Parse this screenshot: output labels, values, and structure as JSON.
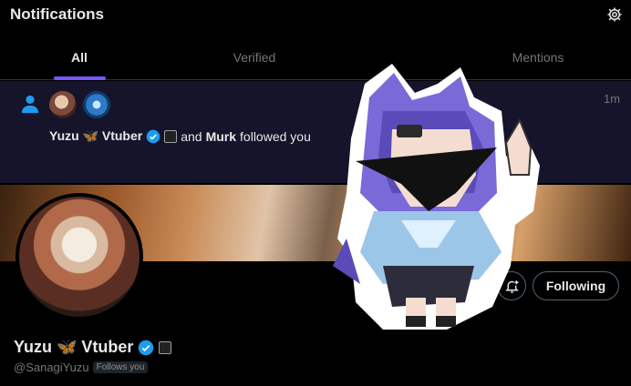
{
  "header": {
    "title": "Notifications",
    "settings_icon": "gear-icon"
  },
  "tabs": [
    {
      "label": "All",
      "active": true
    },
    {
      "label": "Verified",
      "active": false
    },
    {
      "label": "Mentions",
      "active": false
    }
  ],
  "notification": {
    "time": "1m",
    "name1": "Yuzu 🦋 Vtuber",
    "connector": "and",
    "name2": "Murk",
    "action": "followed you"
  },
  "profile": {
    "name": "Yuzu 🦋 Vtuber",
    "handle": "@SanagiYuzu",
    "follows_you": "Follows you",
    "following_label": "Following"
  },
  "colors": {
    "accent": "#7856ff",
    "verified": "#1d9bf0",
    "notif_bg": "#16142a"
  }
}
